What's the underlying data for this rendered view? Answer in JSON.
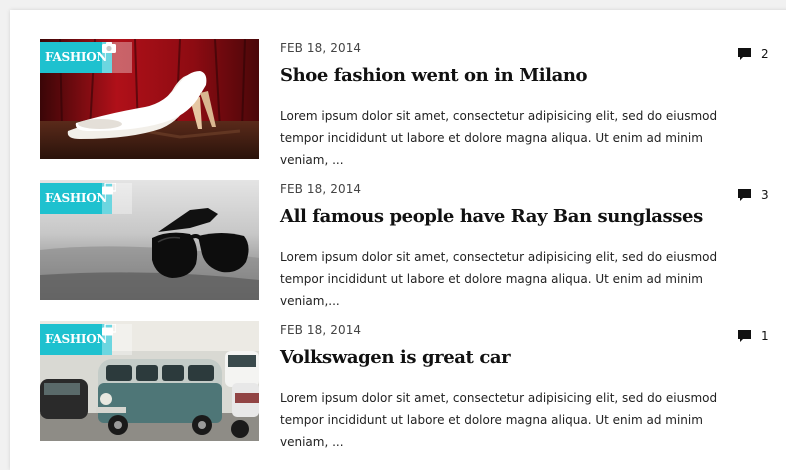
{
  "posts": [
    {
      "category": "FASHION",
      "format_icon": "camera-icon",
      "date": "FEB 18, 2014",
      "title": "Shoe fashion went on in Milano",
      "excerpt": "Lorem ipsum dolor sit amet, consectetur adipisicing elit, sed do eiusmod tempor incididunt ut labore et dolore magna aliqua. Ut enim ad minim veniam, ...",
      "comment_count": "2",
      "image": "white-high-heel-shoes-on-red-background"
    },
    {
      "category": "FASHION",
      "format_icon": "gallery-icon",
      "date": "FEB 18, 2014",
      "title": "All famous people have Ray Ban sunglasses",
      "excerpt": "Lorem ipsum dolor sit amet, consectetur adipisicing elit, sed do eiusmod tempor incididunt ut labore et dolore magna aliqua. Ut enim ad minim veniam,...",
      "comment_count": "3",
      "image": "black-sunglasses-on-grey-ground"
    },
    {
      "category": "FASHION",
      "format_icon": "gallery-icon",
      "date": "FEB 18, 2014",
      "title": "Volkswagen is great car",
      "excerpt": "Lorem ipsum dolor sit amet, consectetur adipisicing elit, sed do eiusmod tempor incididunt ut labore et dolore magna aliqua. Ut enim ad minim veniam, ...",
      "comment_count": "1",
      "image": "vintage-volkswagen-van-on-street"
    }
  ],
  "colors": {
    "accent": "#1ec1cf",
    "title": "#111111",
    "text": "#222222"
  },
  "icons": {
    "comment": "speech-bubble-icon"
  }
}
